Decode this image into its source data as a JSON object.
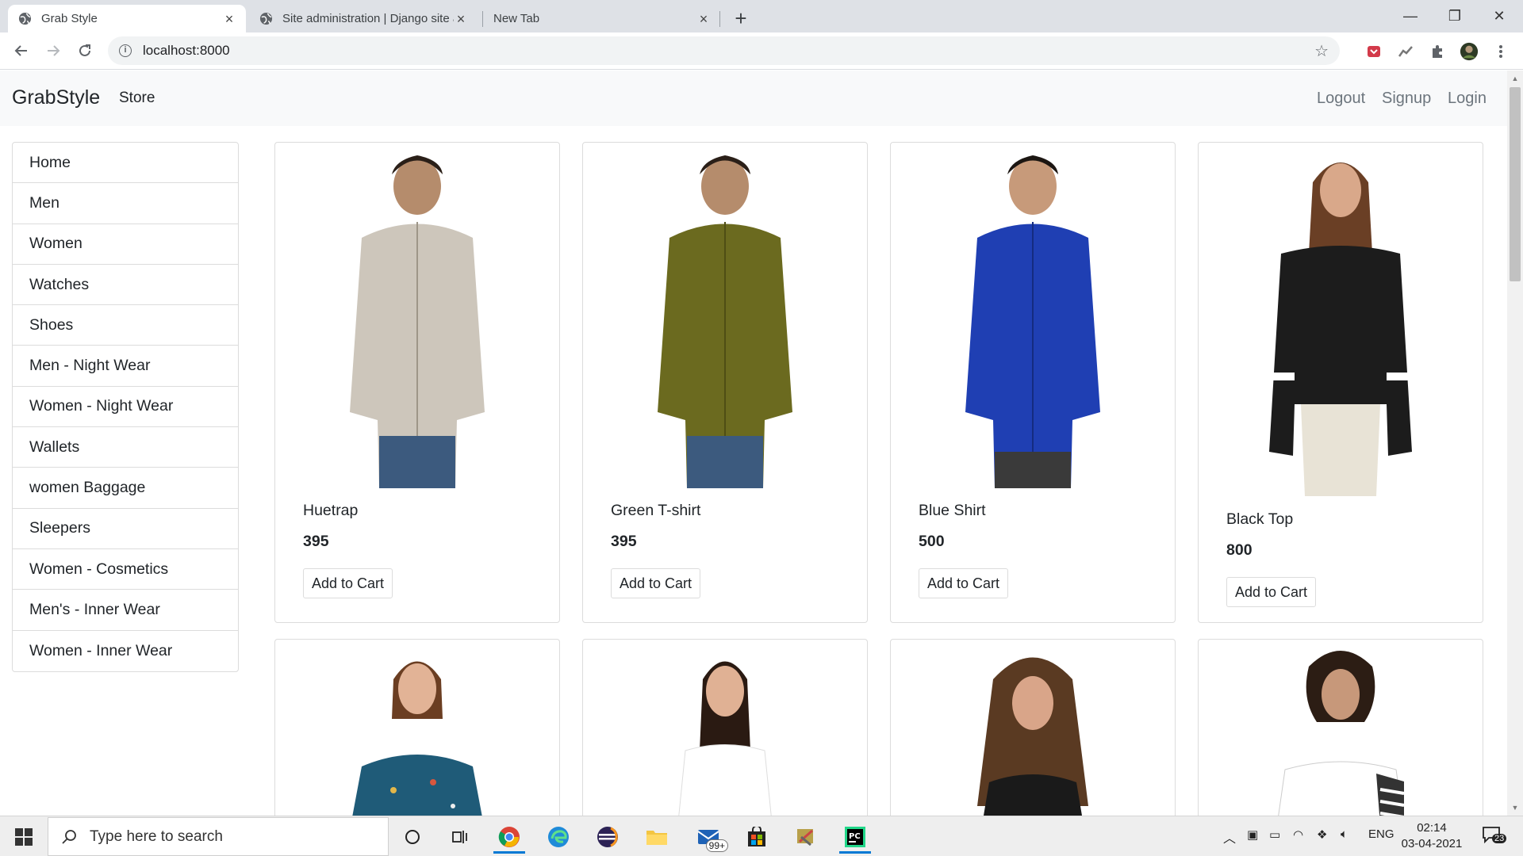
{
  "browser": {
    "tabs": [
      {
        "title": "Grab Style",
        "active": true
      },
      {
        "title": "Site administration | Django site admin",
        "active": false
      },
      {
        "title": "New Tab",
        "active": false
      }
    ],
    "new_tab_label": "+",
    "url": "localhost:8000",
    "window_controls": {
      "minimize": "—",
      "maximize": "❐",
      "close": "✕"
    }
  },
  "site": {
    "brand": "GrabStyle",
    "nav_link": "Store",
    "right_links": [
      "Logout",
      "Signup",
      "Login"
    ]
  },
  "sidebar": {
    "items": [
      {
        "label": "Home"
      },
      {
        "label": "Men"
      },
      {
        "label": "Women"
      },
      {
        "label": "Watches"
      },
      {
        "label": "Shoes"
      },
      {
        "label": "Men - Night Wear"
      },
      {
        "label": "Women - Night Wear"
      },
      {
        "label": "Wallets"
      },
      {
        "label": "women Baggage"
      },
      {
        "label": "Sleepers"
      },
      {
        "label": "Women - Cosmetics"
      },
      {
        "label": "Men's - Inner Wear"
      },
      {
        "label": "Women - Inner Wear"
      }
    ]
  },
  "products": [
    {
      "name": "Huetrap",
      "price": "395",
      "button": "Add to Cart",
      "color": "#cdc6bb"
    },
    {
      "name": "Green T-shirt",
      "price": "395",
      "button": "Add to Cart",
      "color": "#6b6a1f"
    },
    {
      "name": "Blue Shirt",
      "price": "500",
      "button": "Add to Cart",
      "color": "#1f3fb3"
    },
    {
      "name": "Black Top",
      "price": "800",
      "button": "Add to Cart",
      "color": "#1c1c1c"
    }
  ],
  "second_row_colors": [
    "#1f5b78",
    "#ffffff",
    "#1a1a1a",
    "#ffffff"
  ],
  "taskbar": {
    "search_placeholder": "Type here to search",
    "mail_badge": "99+",
    "language": "ENG",
    "time": "02:14",
    "date": "03-04-2021",
    "notification_count": "23"
  }
}
